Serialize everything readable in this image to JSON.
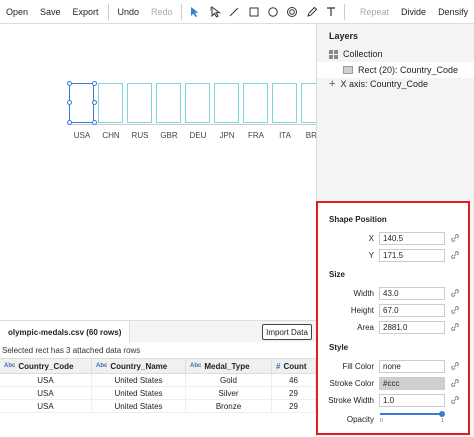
{
  "toolbar": {
    "open": "Open",
    "save": "Save",
    "export": "Export",
    "undo": "Undo",
    "redo": "Redo",
    "repeat": "Repeat",
    "divide": "Divide",
    "densify": "Densify",
    "tools": [
      "select-arrow-icon",
      "direct-select-icon",
      "line-icon",
      "rect-icon",
      "circle-icon",
      "ring-icon",
      "pen-icon",
      "text-icon"
    ]
  },
  "canvas": {
    "ticks": [
      "USA",
      "CHN",
      "RUS",
      "GBR",
      "DEU",
      "JPN",
      "FRA",
      "ITA",
      "BRA"
    ]
  },
  "layers": {
    "title": "Layers",
    "items": [
      "Collection",
      "Rect (20): Country_Code",
      "X axis: Country_Code"
    ]
  },
  "props": {
    "shape_position": "Shape Position",
    "x_label": "X",
    "x_value": "140.5",
    "y_label": "Y",
    "y_value": "171.5",
    "size": "Size",
    "width_label": "Width",
    "width_value": "43.0",
    "height_label": "Height",
    "height_value": "67.0",
    "area_label": "Area",
    "area_value": "2881.0",
    "style": "Style",
    "fill_label": "Fill Color",
    "fill_value": "none",
    "stroke_label": "Stroke Color",
    "stroke_value": "#ccc",
    "stroke_width_label": "Stroke Width",
    "stroke_width_value": "1.0",
    "opacity_label": "Opacity",
    "opacity_min": "0",
    "opacity_max": "1"
  },
  "data_panel": {
    "file_tab": "olympic-medals.csv (60 rows)",
    "import_button": "Import Data",
    "status": "Selected rect has 3 attached data rows",
    "columns": [
      "Country_Code",
      "Country_Name",
      "Medal_Type",
      "Count"
    ],
    "rows": [
      [
        "USA",
        "United States",
        "Gold",
        "46"
      ],
      [
        "USA",
        "United States",
        "Silver",
        "29"
      ],
      [
        "USA",
        "United States",
        "Bronze",
        "29"
      ]
    ]
  },
  "colors": {
    "accent": "#3a7bd5",
    "highlight_border": "#e02020",
    "bar_stroke": "#7fd6dc"
  }
}
